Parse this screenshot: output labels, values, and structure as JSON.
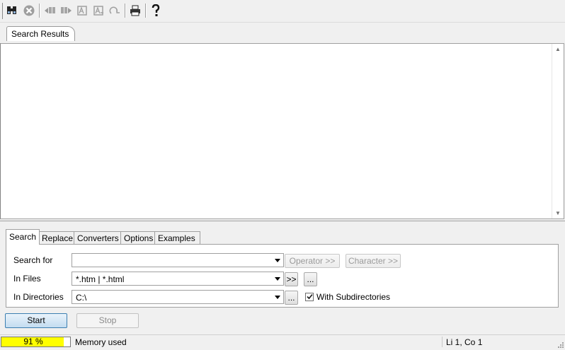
{
  "toolbar": {
    "buttons": [
      {
        "icon": "binoculars-icon",
        "label": "Find",
        "enabled": true
      },
      {
        "icon": "stop-circle-icon",
        "label": "Cancel",
        "enabled": false
      },
      {
        "icon": "find-previous-icon",
        "label": "Previous",
        "enabled": false
      },
      {
        "icon": "find-next-icon",
        "label": "Next",
        "enabled": false
      },
      {
        "icon": "edit-icon",
        "label": "Edit",
        "enabled": false
      },
      {
        "icon": "replace-icon",
        "label": "Replace",
        "enabled": false
      },
      {
        "icon": "undo-icon",
        "label": "Undo",
        "enabled": false
      },
      {
        "icon": "print-icon",
        "label": "Print",
        "enabled": true
      },
      {
        "icon": "help-icon",
        "label": "Help",
        "enabled": true
      }
    ]
  },
  "results": {
    "tab_label": "Search Results"
  },
  "tabs": [
    "Search",
    "Replace",
    "Converters",
    "Options",
    "Examples"
  ],
  "active_tab": "Search",
  "search": {
    "search_for_label": "Search for",
    "search_for_value": "",
    "operator_button": "Operator >>",
    "character_button": "Character >>",
    "in_files_label": "In Files",
    "in_files_value": "*.htm | *.html",
    "insert_button": ">>",
    "browse_button": "...",
    "in_directories_label": "In Directories",
    "in_directories_value": "C:\\",
    "browse_dir_button": "...",
    "with_subdirectories_label": "With Subdirectories",
    "with_subdirectories_checked": true
  },
  "actions": {
    "start": "Start",
    "stop": "Stop"
  },
  "status": {
    "memory_percent": "91 %",
    "memory_fraction": 0.91,
    "memory_label": "Memory used",
    "cursor_position": "Li 1, Co 1"
  },
  "colors": {
    "memory_fill": "#ffff00",
    "start_button_border": "#3c7fb1"
  }
}
